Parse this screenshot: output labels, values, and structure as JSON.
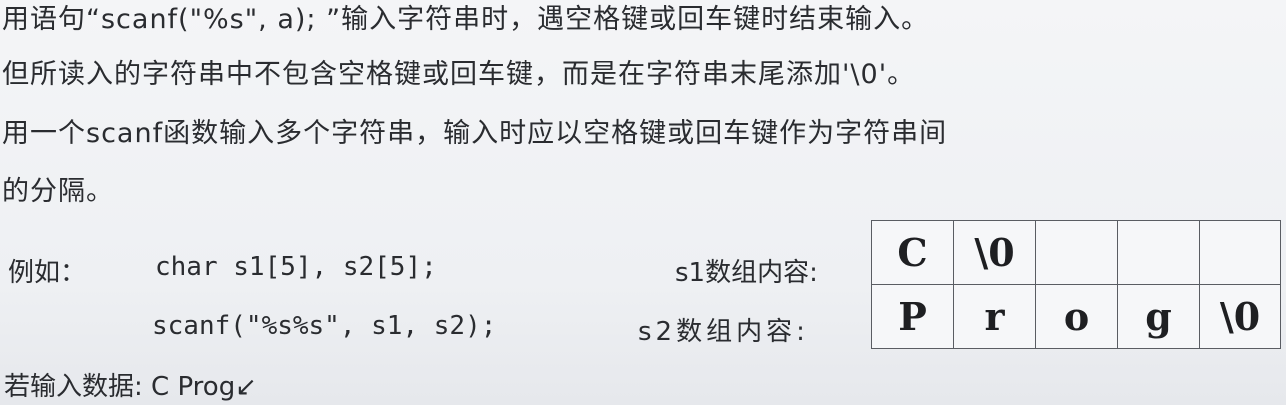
{
  "paragraph": {
    "line1": "用语句“scanf(\"%s\", a); ”输入字符串时，遇空格键或回车键时结束输入。",
    "line2": "但所读入的字符串中不包含空格键或回车键，而是在字符串末尾添加'\\0'。",
    "line3": "用一个scanf函数输入多个字符串，输入时应以空格键或回车键作为字符串间",
    "line4": "的分隔。"
  },
  "example": {
    "label": "例如：",
    "code_line1": "char s1[5], s2[5];",
    "code_line2": "scanf(\"%s%s\", s1, s2);",
    "s1_label": "s1数组内容:",
    "s2_label": "s2数组内容:",
    "s1_cells": [
      "C",
      "\\0",
      "",
      "",
      ""
    ],
    "s2_cells": [
      "P",
      "r",
      "o",
      "g",
      "\\0"
    ]
  },
  "input_line": "若输入数据: C   Prog↙"
}
